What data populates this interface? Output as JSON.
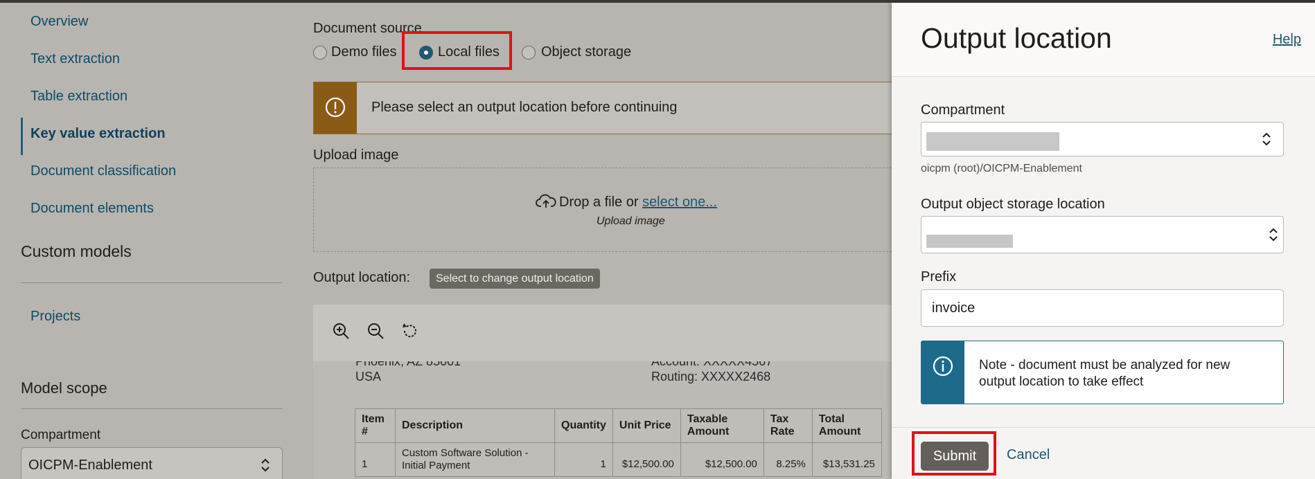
{
  "nav": {
    "items": [
      {
        "label": "Overview",
        "active": false
      },
      {
        "label": "Text extraction",
        "active": false
      },
      {
        "label": "Table extraction",
        "active": false
      },
      {
        "label": "Key value extraction",
        "active": true
      },
      {
        "label": "Document classification",
        "active": false
      },
      {
        "label": "Document elements",
        "active": false
      }
    ],
    "custom_models_heading": "Custom models",
    "projects_label": "Projects",
    "model_scope_heading": "Model scope",
    "compartment_label": "Compartment",
    "compartment_value": "OICPM-Enablement"
  },
  "main": {
    "document_source_label": "Document source",
    "sources": [
      {
        "label": "Demo files",
        "checked": false
      },
      {
        "label": "Local files",
        "checked": true
      },
      {
        "label": "Object storage",
        "checked": false
      }
    ],
    "warning_text": "Please select an output location before continuing",
    "upload_label": "Upload image",
    "drop_text": "Drop a file or",
    "drop_link": "select one...",
    "drop_sub": "Upload image",
    "output_location_label": "Output location:",
    "output_tooltip": "Select to change output location",
    "preview": {
      "addr_line1": "Phoenix, AZ 85001",
      "addr_line2": "USA",
      "acct_line": "Account: XXXXX4567",
      "routing_line": "Routing: XXXXX2468",
      "table_headers": [
        "Item #",
        "Description",
        "Quantity",
        "Unit Price",
        "Taxable Amount",
        "Tax Rate",
        "Total Amount"
      ],
      "row": [
        "1",
        "Custom Software Solution - Initial Payment",
        "1",
        "$12,500.00",
        "$12,500.00",
        "8.25%",
        "$13,531.25"
      ]
    }
  },
  "drawer": {
    "title": "Output location",
    "help": "Help",
    "compartment_label": "Compartment",
    "compartment_path": "oicpm (root)/OICPM-Enablement",
    "storage_label": "Output object storage location",
    "prefix_label": "Prefix",
    "prefix_value": "invoice",
    "note": "Note - document must be analyzed for new output location to take effect",
    "submit": "Submit",
    "cancel": "Cancel"
  },
  "colors": {
    "accent": "#1f5573",
    "highlight": "#e0121b",
    "warning": "#8a5b17",
    "info": "#1d6a8a"
  }
}
